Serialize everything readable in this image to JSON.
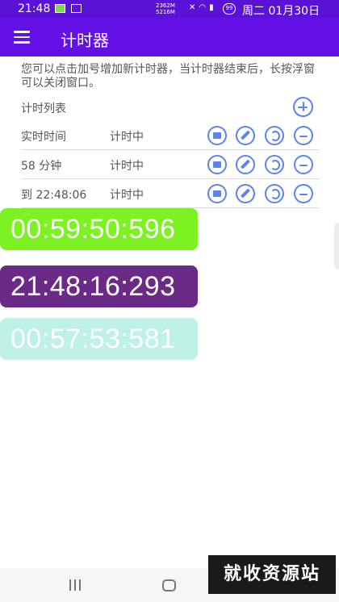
{
  "status_bar": {
    "time": "21:48",
    "network_speed_up": "2362M",
    "network_speed_down": "5216M",
    "battery": "99",
    "date": "周二 01月30日"
  },
  "app_bar": {
    "title": "计时器",
    "menu_icon": "menu-icon"
  },
  "hint": "您可以点击加号增加新计时器，当计时器结束后，长按浮窗可以关闭窗口。",
  "list": {
    "header": "计时列表",
    "add_icon": "add-circle-icon",
    "rows": [
      {
        "name": "实时时间",
        "state": "计时中"
      },
      {
        "name": "58 分钟",
        "state": "计时中"
      },
      {
        "name": "到 22:48:06",
        "state": "计时中"
      }
    ],
    "row_action_icons": [
      "stop-icon",
      "edit-icon",
      "reset-icon",
      "remove-icon"
    ]
  },
  "floating_timers": [
    {
      "time": "00:59:50:596",
      "color": "#7cf222"
    },
    {
      "time": "21:48:16:293",
      "color": "#6a2a86"
    },
    {
      "time": "00:57:53:581",
      "color": "#bff2e7"
    }
  ],
  "accent_color": "#5b84f0",
  "app_bar_color": "#6311e6",
  "watermark": "就收资源站"
}
